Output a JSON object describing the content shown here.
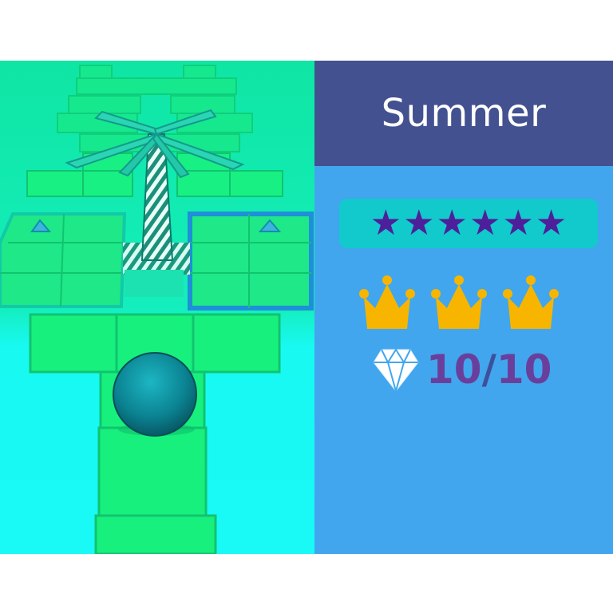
{
  "level": {
    "title": "Summer"
  },
  "rating": {
    "stars": [
      "★",
      "★",
      "★",
      "★",
      "★",
      "★"
    ],
    "star_color": "#4e1f9a"
  },
  "crowns": {
    "earned": 3,
    "total": 3,
    "color": "#f7b500"
  },
  "gems": {
    "collected": "10",
    "separator": "/",
    "total": "10"
  },
  "colors": {
    "panel_header": "#435190",
    "panel_body": "#41a6ee",
    "stars_bar": "#12c9cc",
    "tile_green": "#19f27c",
    "sky_cyan": "#17f7f1",
    "ball": "#0d8a98"
  }
}
